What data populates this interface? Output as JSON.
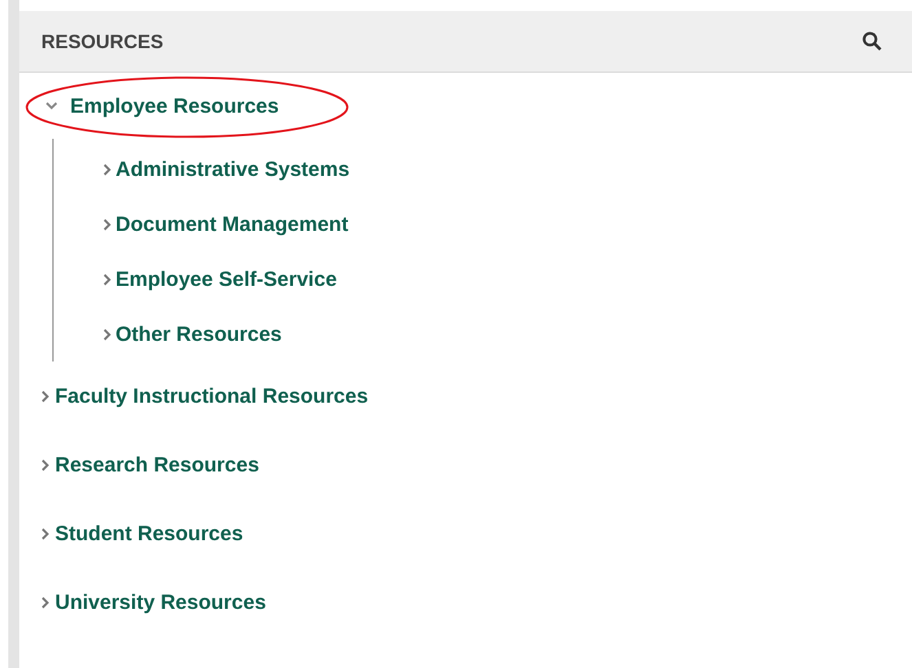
{
  "panel": {
    "title": "RESOURCES"
  },
  "tree": [
    {
      "label": "Employee Resources",
      "expanded": true,
      "circled": true,
      "children": [
        {
          "label": "Administrative Systems"
        },
        {
          "label": "Document Management"
        },
        {
          "label": "Employee Self-Service"
        },
        {
          "label": "Other Resources"
        }
      ]
    },
    {
      "label": "Faculty Instructional Resources",
      "expanded": false,
      "circled": false
    },
    {
      "label": "Research Resources",
      "expanded": false,
      "circled": false
    },
    {
      "label": "Student Resources",
      "expanded": false,
      "circled": false
    },
    {
      "label": "University Resources",
      "expanded": false,
      "circled": false
    }
  ]
}
